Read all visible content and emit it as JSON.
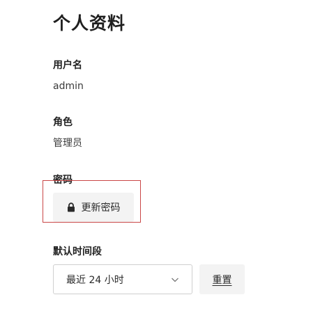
{
  "page": {
    "title": "个人资料"
  },
  "fields": {
    "username": {
      "label": "用户名",
      "value": "admin"
    },
    "role": {
      "label": "角色",
      "value": "管理员"
    },
    "password": {
      "label": "密码",
      "button_label": "更新密码",
      "button_icon": "lock-icon"
    },
    "default_time_range": {
      "label": "默认时间段",
      "selected": "最近 24 小时",
      "dropdown_icon": "chevron-down-icon",
      "reset_label": "重置"
    }
  },
  "colors": {
    "highlight_border": "#c94646",
    "button_bg": "#f3f3f3",
    "select_border": "#cfcfcf"
  }
}
